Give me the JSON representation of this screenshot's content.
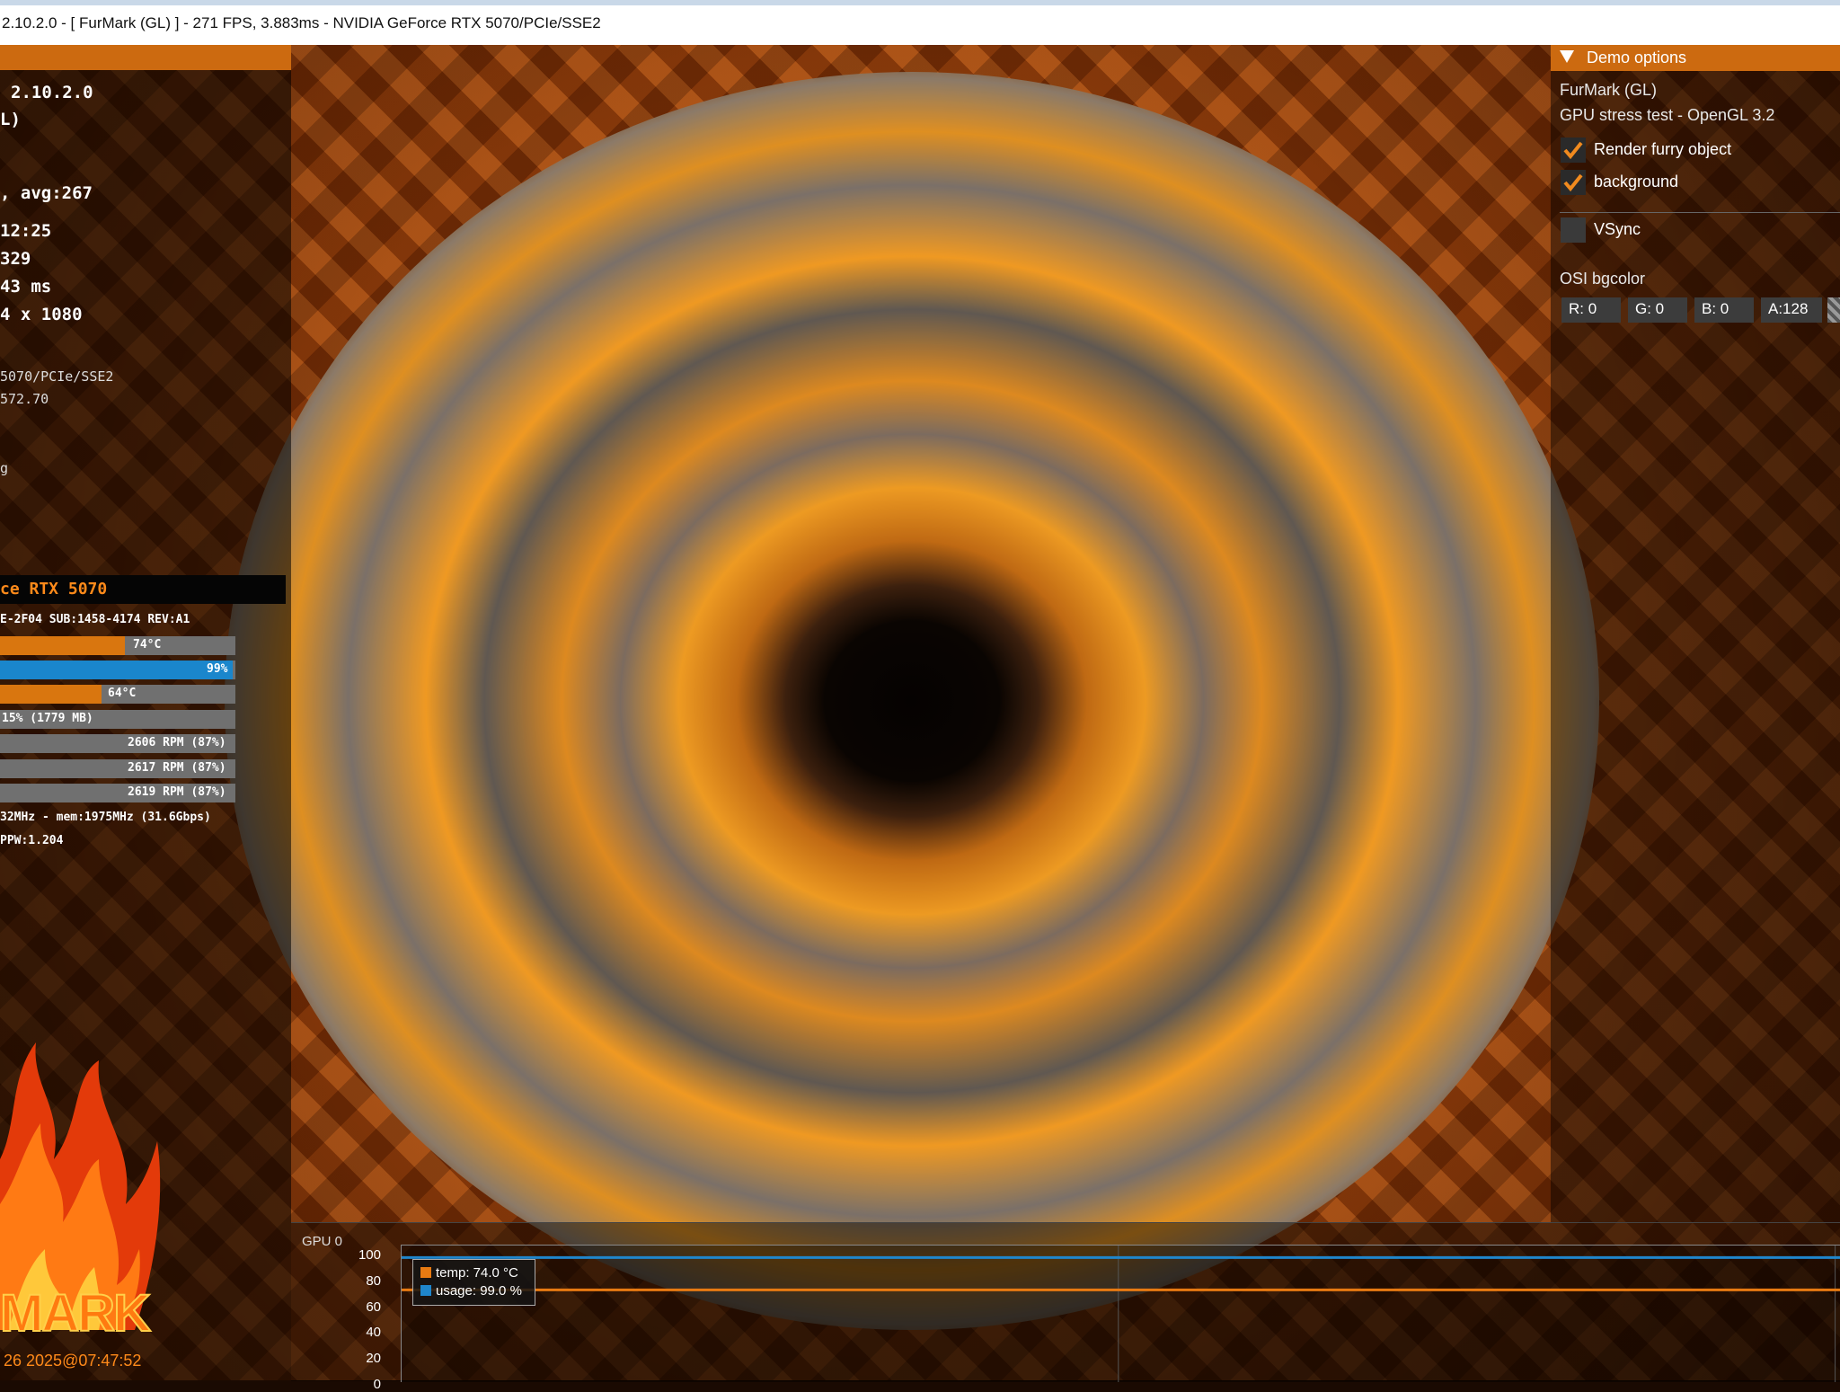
{
  "window": {
    "title": "2.10.2.0 - [ FurMark (GL) ] - 271 FPS, 3.883ms - NVIDIA GeForce RTX 5070/PCIe/SSE2"
  },
  "osd": {
    "version": "2.10.2.0",
    "api": "L)",
    "fps_avg": ", avg:267",
    "time": "12:25",
    "frames": "329",
    "frametime": "43 ms",
    "resolution": "4 x 1080",
    "renderer": "5070/PCIe/SSE2",
    "driver": "572.70",
    "misc": "g",
    "gpu_name": "ce RTX 5070",
    "gpu_ids": "E-2F04 SUB:1458-4174 REV:A1",
    "meters": [
      {
        "label": "74°C",
        "value_pct": 53,
        "color": "#d9760f"
      },
      {
        "label": "99%",
        "value_pct": 99,
        "color": "#1a86cc"
      },
      {
        "label": "64°C",
        "value_pct": 43,
        "color": "#d9760f"
      },
      {
        "label": "15% (1779 MB)",
        "value_pct": 0,
        "color": "#707070"
      },
      {
        "label": "2606 RPM (87%)",
        "value_pct": 0,
        "color": "#707070"
      },
      {
        "label": "2617 RPM (87%)",
        "value_pct": 0,
        "color": "#707070"
      },
      {
        "label": "2619 RPM (87%)",
        "value_pct": 0,
        "color": "#707070"
      }
    ],
    "clocks": "32MHz - mem:1975MHz (31.6Gbps)",
    "ppw": "PPW:1.204"
  },
  "logo": {
    "text": "MARK"
  },
  "timestamp": "26 2025@07:47:52",
  "demo_options": {
    "header": "Demo options",
    "app_name": "FurMark (GL)",
    "description": "GPU stress test - OpenGL 3.2",
    "render_furry": {
      "label": "Render furry object",
      "checked": true
    },
    "background": {
      "label": "background",
      "checked": true
    },
    "vsync": {
      "label": "VSync",
      "checked": false
    },
    "bgcolor_label": "OSI bgcolor",
    "bgcolor": {
      "r": "R: 0",
      "g": "G: 0",
      "b": "B: 0",
      "a": "A:128"
    }
  },
  "graph": {
    "title": "GPU 0",
    "legend_temp": "temp: 74.0 °C",
    "legend_usage": "usage: 99.0 %",
    "colors": {
      "temp": "#e87a12",
      "usage": "#1f86cc"
    }
  },
  "chart_data": {
    "type": "line",
    "ylim": [
      0,
      100
    ],
    "yticks": [
      "100",
      "80",
      "60",
      "40",
      "20",
      "0"
    ],
    "series": [
      {
        "name": "temp: 74.0 °C",
        "values": [
          74,
          74,
          74,
          74,
          74,
          74,
          74,
          74,
          74,
          74,
          74
        ]
      },
      {
        "name": "usage: 99.0 %",
        "values": [
          99,
          99,
          99,
          99,
          99,
          99,
          99,
          99,
          99,
          99,
          99
        ]
      }
    ]
  }
}
